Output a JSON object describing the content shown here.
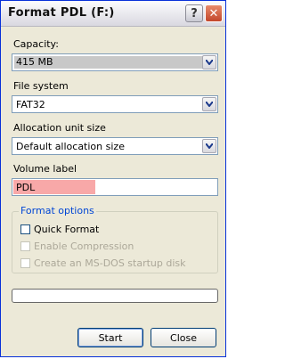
{
  "window": {
    "title": "Format PDL (F:)",
    "help_glyph": "?",
    "close_glyph": "✕"
  },
  "capacity": {
    "label": "Capacity:",
    "value": "415 MB"
  },
  "file_system": {
    "label": "File system",
    "value": "FAT32"
  },
  "allocation": {
    "label": "Allocation unit size",
    "value": "Default allocation size"
  },
  "volume": {
    "label": "Volume label",
    "value": "PDL"
  },
  "format_options": {
    "title": "Format options",
    "quick_format": {
      "label": "Quick Format",
      "checked": false,
      "enabled": true
    },
    "compression": {
      "label": "Enable Compression",
      "checked": false,
      "enabled": false
    },
    "startup_disk": {
      "label": "Create an MS-DOS startup disk",
      "checked": false,
      "enabled": false
    }
  },
  "progress": {
    "value": 0
  },
  "buttons": {
    "start": "Start",
    "close": "Close"
  },
  "colors": {
    "accent": "#0046d5",
    "close_button": "#c3462b",
    "highlight": "#f8a8a8"
  }
}
